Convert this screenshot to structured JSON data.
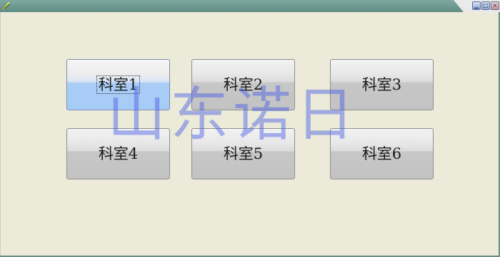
{
  "window": {
    "icon": "app-feather-icon",
    "controls": [
      "minimize-icon",
      "maximize-icon",
      "close-icon"
    ]
  },
  "departments": [
    {
      "label": "科室1",
      "selected": true
    },
    {
      "label": "科室2",
      "selected": false
    },
    {
      "label": "科室3",
      "selected": false
    },
    {
      "label": "科室4",
      "selected": false
    },
    {
      "label": "科室5",
      "selected": false
    },
    {
      "label": "科室6",
      "selected": false
    }
  ],
  "watermark": "山东诺日",
  "colors": {
    "titlebar": "#6a8f87",
    "client_background": "#ecebd9",
    "selected_button": "#a6cbf5",
    "button_face": "#c3c3c3",
    "watermark": "#465ae6"
  }
}
